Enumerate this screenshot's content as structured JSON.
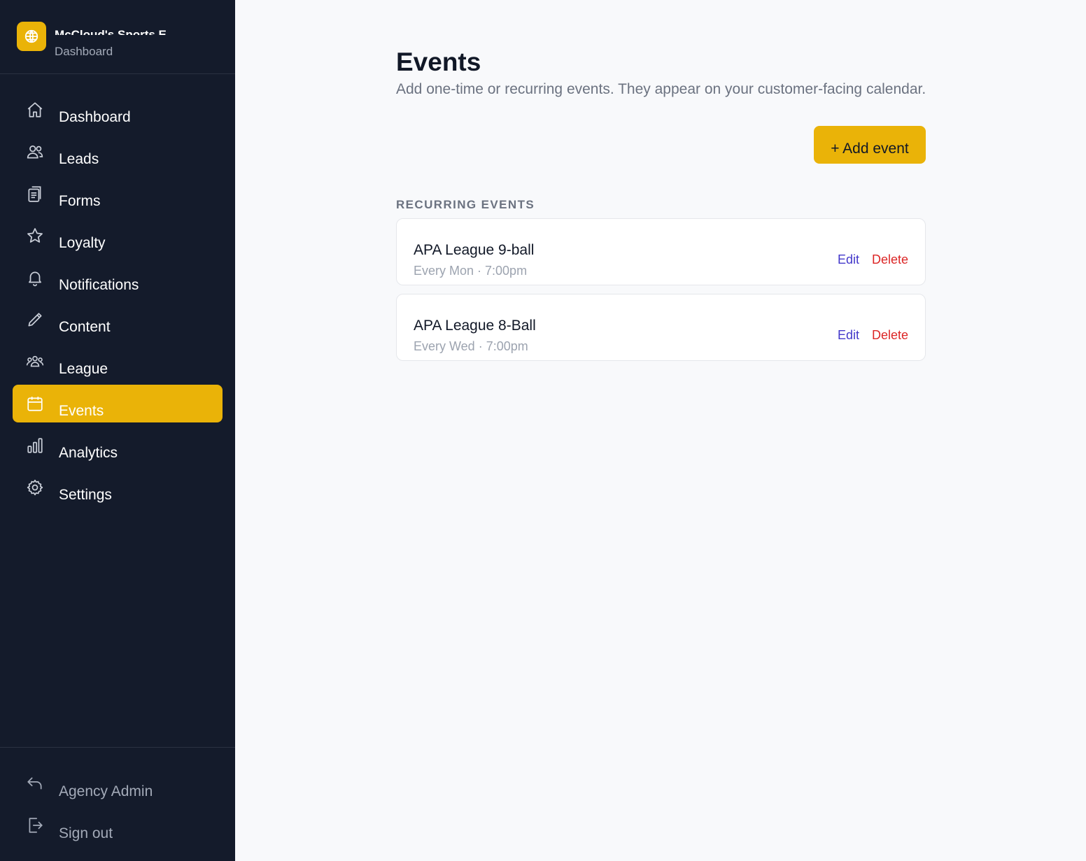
{
  "brand": {
    "name": "McCloud's Sports E",
    "subtitle": "Dashboard",
    "logo_icon": "globe-icon"
  },
  "sidebar": {
    "items": [
      {
        "label": "Dashboard",
        "icon": "home-icon"
      },
      {
        "label": "Leads",
        "icon": "users-icon"
      },
      {
        "label": "Forms",
        "icon": "clipboard-icon"
      },
      {
        "label": "Loyalty",
        "icon": "star-icon"
      },
      {
        "label": "Notifications",
        "icon": "bell-icon"
      },
      {
        "label": "Content",
        "icon": "pencil-icon"
      },
      {
        "label": "League",
        "icon": "group-icon"
      },
      {
        "label": "Events",
        "icon": "calendar-icon",
        "active": true
      },
      {
        "label": "Analytics",
        "icon": "bar-chart-icon"
      },
      {
        "label": "Settings",
        "icon": "gear-icon"
      }
    ],
    "bottom": [
      {
        "label": "Agency Admin",
        "icon": "return-arrow-icon"
      },
      {
        "label": "Sign out",
        "icon": "sign-out-icon"
      }
    ]
  },
  "main": {
    "title": "Events",
    "subtitle": "Add one-time or recurring events. They appear on your customer-facing calendar.",
    "add_button": "+ Add event",
    "section_label": "RECURRING EVENTS",
    "events": [
      {
        "name": "APA League 9-ball",
        "schedule": "Every Mon · 7:00pm",
        "edit": "Edit",
        "delete": "Delete"
      },
      {
        "name": "APA League 8-Ball",
        "schedule": "Every Wed · 7:00pm",
        "edit": "Edit",
        "delete": "Delete"
      }
    ]
  },
  "colors": {
    "sidebar_bg": "#141b2b",
    "accent": "#eab308",
    "edit": "#4338ca",
    "delete": "#dc2626"
  }
}
